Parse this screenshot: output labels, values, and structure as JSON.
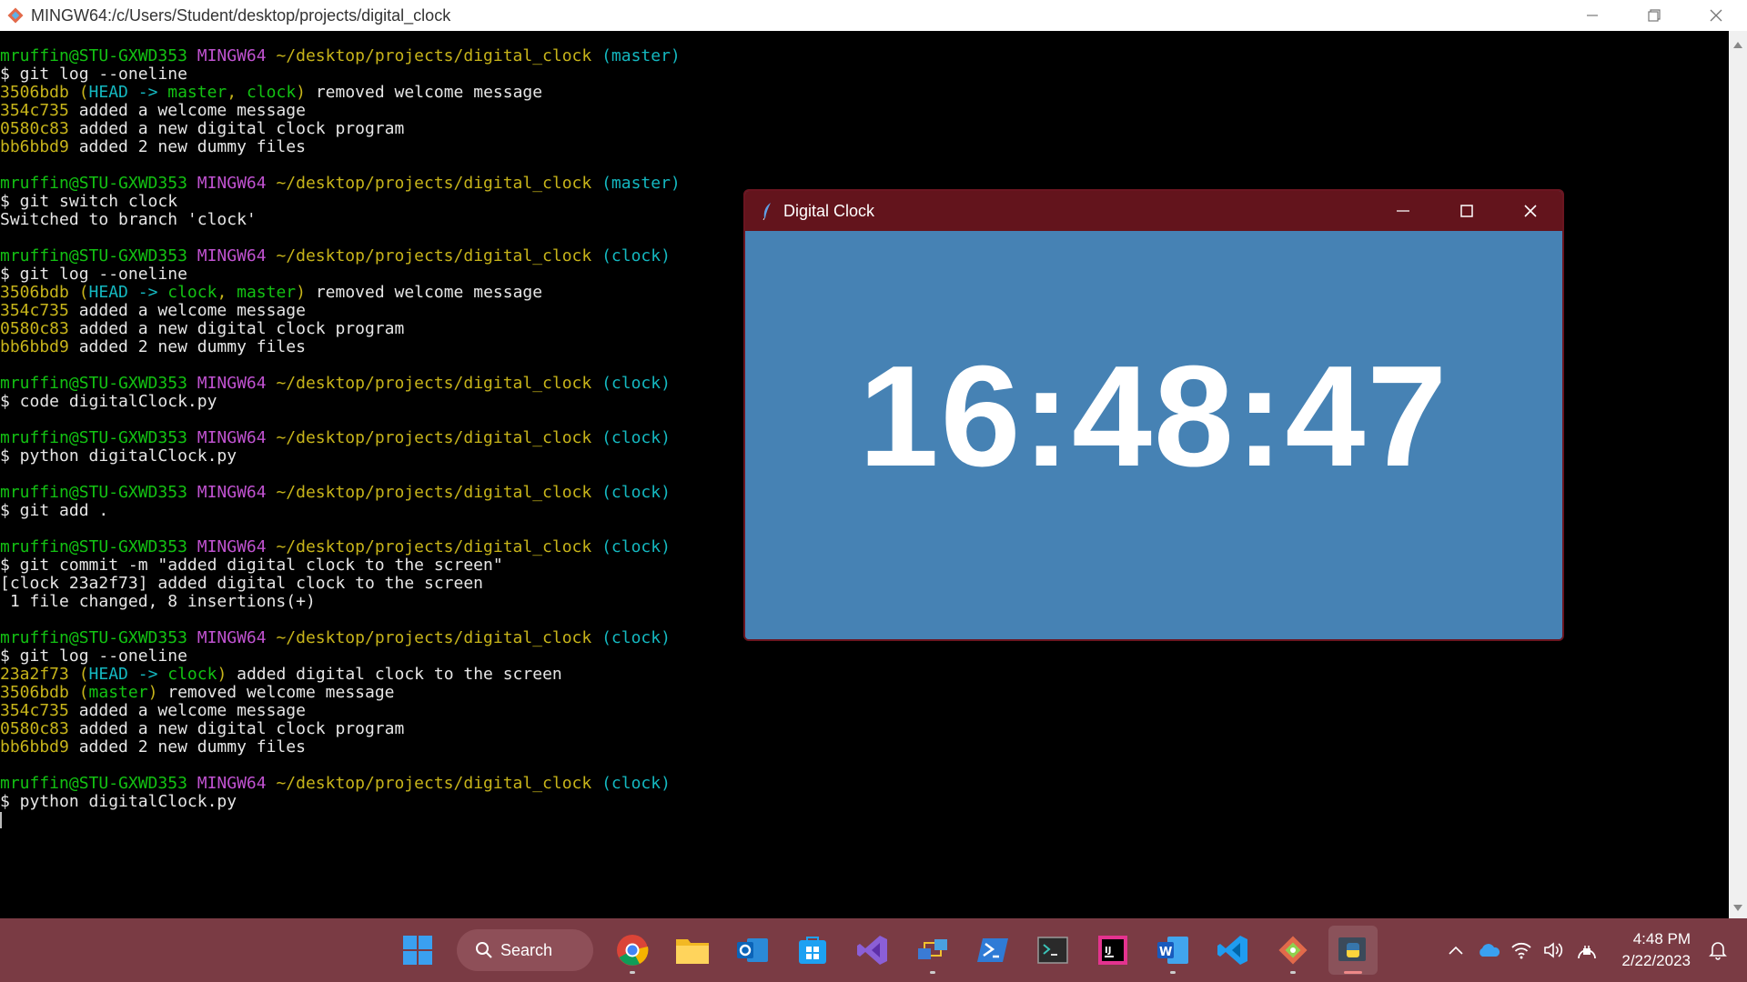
{
  "terminal": {
    "window_title": "MINGW64:/c/Users/Student/desktop/projects/digital_clock",
    "prompt": {
      "user": "mruffin@STU-GXWD353",
      "system": "MINGW64",
      "path": "~/desktop/projects/digital_clock"
    },
    "blocks": [
      {
        "branch": "(master)",
        "command": "$ git log --oneline",
        "output": [
          {
            "hash": "3506bdb",
            "refs": "HEAD -> master, clock",
            "msg": " removed welcome message"
          },
          {
            "hash": "354c735",
            "msg": " added a welcome message"
          },
          {
            "hash": "0580c83",
            "msg": " added a new digital clock program"
          },
          {
            "hash": "bb6bbd9",
            "msg": " added 2 new dummy files"
          }
        ]
      },
      {
        "branch": "(master)",
        "command": "$ git switch clock",
        "text_output": [
          "Switched to branch 'clock'"
        ]
      },
      {
        "branch": "(clock)",
        "command": "$ git log --oneline",
        "output": [
          {
            "hash": "3506bdb",
            "refs": "HEAD -> clock, master",
            "msg": " removed welcome message"
          },
          {
            "hash": "354c735",
            "msg": " added a welcome message"
          },
          {
            "hash": "0580c83",
            "msg": " added a new digital clock program"
          },
          {
            "hash": "bb6bbd9",
            "msg": " added 2 new dummy files"
          }
        ]
      },
      {
        "branch": "(clock)",
        "command": "$ code digitalClock.py"
      },
      {
        "branch": "(clock)",
        "command": "$ python digitalClock.py"
      },
      {
        "branch": "(clock)",
        "command": "$ git add ."
      },
      {
        "branch": "(clock)",
        "command": "$ git commit -m \"added digital clock to the screen\"",
        "text_output": [
          "[clock 23a2f73] added digital clock to the screen",
          " 1 file changed, 8 insertions(+)"
        ]
      },
      {
        "branch": "(clock)",
        "command": "$ git log --oneline",
        "output": [
          {
            "hash": "23a2f73",
            "refs": "HEAD -> clock",
            "msg": " added digital clock to the screen"
          },
          {
            "hash": "3506bdb",
            "refs": "master",
            "msg": " removed welcome message"
          },
          {
            "hash": "354c735",
            "msg": " added a welcome message"
          },
          {
            "hash": "0580c83",
            "msg": " added a new digital clock program"
          },
          {
            "hash": "bb6bbd9",
            "msg": " added 2 new dummy files"
          }
        ]
      },
      {
        "branch": "(clock)",
        "command": "$ python digitalClock.py",
        "cursor": true
      }
    ]
  },
  "clock_window": {
    "title": "Digital Clock",
    "time": "16:48:47",
    "background": "#4682b4",
    "titlebar_color": "#63141c"
  },
  "taskbar": {
    "search_label": "Search",
    "apps": [
      "windows-start-icon",
      "chrome-icon",
      "file-explorer-icon",
      "outlook-icon",
      "store-icon",
      "visual-studio-icon",
      "network-tool-icon",
      "powershell-icon",
      "terminal-icon",
      "intellij-icon",
      "word-icon",
      "vscode-icon",
      "git-icon",
      "python-icon"
    ],
    "tray_time": "4:48 PM",
    "tray_date": "2/22/2023",
    "color": "#7a3b44"
  }
}
